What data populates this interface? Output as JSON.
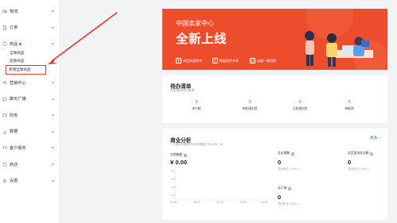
{
  "sidebar": {
    "items": [
      {
        "label": "物流",
        "icon": "truck-icon"
      },
      {
        "label": "订单",
        "icon": "order-icon"
      },
      {
        "label": "商品",
        "icon": "box-icon",
        "dot": true
      },
      {
        "label": "营销中心",
        "icon": "megaphone-icon"
      },
      {
        "label": "聊天广播",
        "icon": "chat-icon"
      },
      {
        "label": "财务",
        "icon": "wallet-icon"
      },
      {
        "label": "数据",
        "icon": "chart-icon"
      },
      {
        "label": "客户服务",
        "icon": "headset-icon"
      },
      {
        "label": "商店",
        "icon": "store-icon"
      },
      {
        "label": "设置",
        "icon": "gear-icon"
      }
    ],
    "product_sub": [
      "全球商品",
      "店铺商品",
      "新增全球商品"
    ]
  },
  "banner": {
    "line1": "中国卖家中心",
    "line2": "全新上线",
    "features": [
      "商品快速发布",
      "数据同步共享",
      "店铺一键切换"
    ],
    "bg_color": "#ee4d2d"
  },
  "todo": {
    "title": "待办清单",
    "subtitle": "您需要处理的事情",
    "items": [
      {
        "value": "0",
        "label": "未付款"
      },
      {
        "value": "0",
        "label": "待处理出货"
      },
      {
        "value": "0",
        "label": "已处理出货"
      },
      {
        "value": "0",
        "label": "待取消"
      }
    ]
  },
  "business": {
    "title": "商业分析",
    "more": "更多",
    "subtitle": "> 下载分析数据 的实时数据汇总 (GMT+8)",
    "sales_label": "总销售额",
    "sales_value": "¥ 0.00",
    "visitors_label": "总访客数",
    "visitors_value": "0",
    "views_label": "总页面浏览次数",
    "views_value": "0",
    "orders_label": "总订单",
    "orders_value": "0",
    "compare": "同比昨日 0.00%",
    "dash": "—",
    "y_ticks": [
      "0.7",
      "0.5",
      "0.3",
      "0.1"
    ],
    "x_ticks": [
      "00:00",
      "06:00",
      "12:00",
      "18:00",
      "24:00"
    ]
  }
}
